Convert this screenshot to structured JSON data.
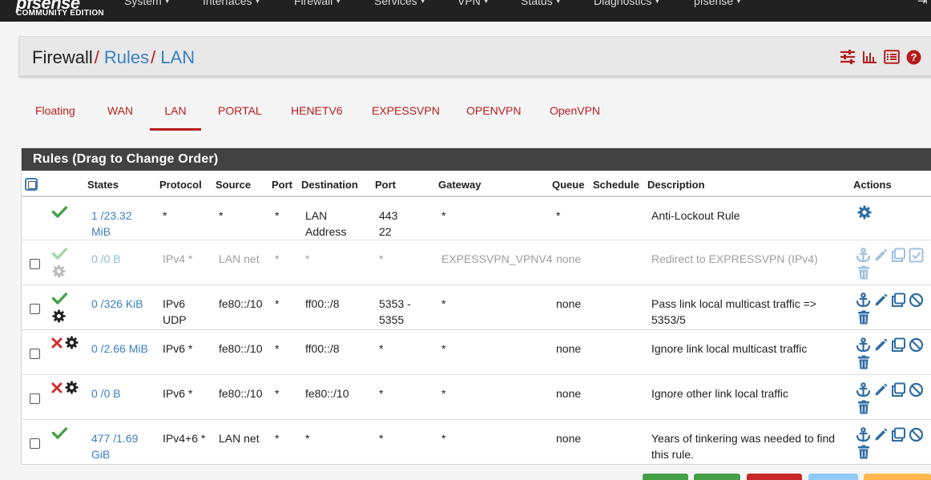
{
  "app": {
    "logo_text": "pfsense",
    "edition": "COMMUNITY EDITION"
  },
  "nav": [
    {
      "label": "System"
    },
    {
      "label": "Interfaces"
    },
    {
      "label": "Firewall"
    },
    {
      "label": "Services"
    },
    {
      "label": "VPN"
    },
    {
      "label": "Status"
    },
    {
      "label": "Diagnostics"
    },
    {
      "label": "pfsense"
    }
  ],
  "breadcrumb": {
    "part1": "Firewall",
    "part2": "Rules",
    "part3": "LAN",
    "separator": "/"
  },
  "tabs": [
    {
      "label": "Floating"
    },
    {
      "label": "WAN"
    },
    {
      "label": "LAN",
      "active": true
    },
    {
      "label": "PORTAL"
    },
    {
      "label": "HENETV6"
    },
    {
      "label": "EXPESSVPN"
    },
    {
      "label": "OPENVPN"
    },
    {
      "label": "OpenVPN"
    }
  ],
  "panel": {
    "title": "Rules (Drag to Change Order)"
  },
  "columns": {
    "states": "States",
    "protocol": "Protocol",
    "source": "Source",
    "port": "Port",
    "destination": "Destination",
    "dport": "Port",
    "gateway": "Gateway",
    "queue": "Queue",
    "schedule": "Schedule",
    "description": "Description",
    "actions": "Actions"
  },
  "rules": [
    {
      "status": "pass",
      "states": "1 /23.32\nMiB",
      "protocol": "*",
      "source": "*",
      "port": "*",
      "destination": "LAN\nAddress",
      "dport": "443\n22",
      "gateway": "*",
      "queue": "*",
      "schedule": "",
      "description": "Anti-Lockout Rule"
    },
    {
      "status": "pass-disabled",
      "states": "0 /0 B",
      "protocol": "IPv4 *",
      "source": "LAN net",
      "port": "*",
      "destination": "*",
      "dport": "*",
      "gateway": "EXPESSVPN_VPNV4",
      "queue": "none",
      "schedule": "",
      "description": "Redirect to EXPRESSVPN (IPv4)"
    },
    {
      "status": "pass",
      "states": "0 /326 KiB",
      "protocol": "IPv6\nUDP",
      "source": "fe80::/10",
      "port": "*",
      "destination": "ff00::/8",
      "dport": "5353 -\n5355",
      "gateway": "*",
      "queue": "none",
      "schedule": "",
      "description": "Pass link local multicast traffic =>\n5353/5"
    },
    {
      "status": "block",
      "states": "0 /2.66 MiB",
      "protocol": "IPv6 *",
      "source": "fe80::/10",
      "port": "*",
      "destination": "ff00::/8",
      "dport": "*",
      "gateway": "*",
      "queue": "none",
      "schedule": "",
      "description": "Ignore link local multicast traffic"
    },
    {
      "status": "block",
      "states": "0 /0 B",
      "protocol": "IPv6 *",
      "source": "fe80::/10",
      "port": "*",
      "destination": "fe80::/10",
      "dport": "*",
      "gateway": "*",
      "queue": "none",
      "schedule": "",
      "description": "Ignore other link local traffic"
    },
    {
      "status": "pass",
      "states": "477 /1.69\nGiB",
      "protocol": "IPv4+6 *",
      "source": "LAN net",
      "port": "*",
      "destination": "*",
      "dport": "*",
      "gateway": "*",
      "queue": "none",
      "schedule": "",
      "description": "Years of tinkering was needed to find\nthis rule."
    }
  ],
  "colors": {
    "accent_red": "#b71c1c",
    "link_blue": "#3a80c3",
    "pass_green": "#43a047",
    "block_red": "#d32f2f",
    "header_dark": "#424242"
  }
}
